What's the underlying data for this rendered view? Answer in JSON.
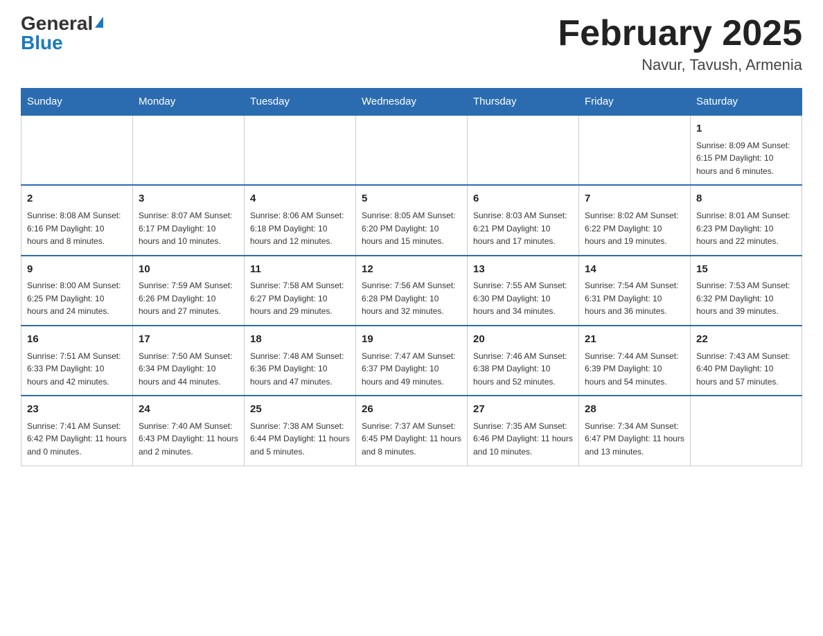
{
  "header": {
    "logo_general": "General",
    "logo_blue": "Blue",
    "month_title": "February 2025",
    "location": "Navur, Tavush, Armenia"
  },
  "weekdays": [
    "Sunday",
    "Monday",
    "Tuesday",
    "Wednesday",
    "Thursday",
    "Friday",
    "Saturday"
  ],
  "weeks": [
    [
      {
        "day": "",
        "info": ""
      },
      {
        "day": "",
        "info": ""
      },
      {
        "day": "",
        "info": ""
      },
      {
        "day": "",
        "info": ""
      },
      {
        "day": "",
        "info": ""
      },
      {
        "day": "",
        "info": ""
      },
      {
        "day": "1",
        "info": "Sunrise: 8:09 AM\nSunset: 6:15 PM\nDaylight: 10 hours and 6 minutes."
      }
    ],
    [
      {
        "day": "2",
        "info": "Sunrise: 8:08 AM\nSunset: 6:16 PM\nDaylight: 10 hours and 8 minutes."
      },
      {
        "day": "3",
        "info": "Sunrise: 8:07 AM\nSunset: 6:17 PM\nDaylight: 10 hours and 10 minutes."
      },
      {
        "day": "4",
        "info": "Sunrise: 8:06 AM\nSunset: 6:18 PM\nDaylight: 10 hours and 12 minutes."
      },
      {
        "day": "5",
        "info": "Sunrise: 8:05 AM\nSunset: 6:20 PM\nDaylight: 10 hours and 15 minutes."
      },
      {
        "day": "6",
        "info": "Sunrise: 8:03 AM\nSunset: 6:21 PM\nDaylight: 10 hours and 17 minutes."
      },
      {
        "day": "7",
        "info": "Sunrise: 8:02 AM\nSunset: 6:22 PM\nDaylight: 10 hours and 19 minutes."
      },
      {
        "day": "8",
        "info": "Sunrise: 8:01 AM\nSunset: 6:23 PM\nDaylight: 10 hours and 22 minutes."
      }
    ],
    [
      {
        "day": "9",
        "info": "Sunrise: 8:00 AM\nSunset: 6:25 PM\nDaylight: 10 hours and 24 minutes."
      },
      {
        "day": "10",
        "info": "Sunrise: 7:59 AM\nSunset: 6:26 PM\nDaylight: 10 hours and 27 minutes."
      },
      {
        "day": "11",
        "info": "Sunrise: 7:58 AM\nSunset: 6:27 PM\nDaylight: 10 hours and 29 minutes."
      },
      {
        "day": "12",
        "info": "Sunrise: 7:56 AM\nSunset: 6:28 PM\nDaylight: 10 hours and 32 minutes."
      },
      {
        "day": "13",
        "info": "Sunrise: 7:55 AM\nSunset: 6:30 PM\nDaylight: 10 hours and 34 minutes."
      },
      {
        "day": "14",
        "info": "Sunrise: 7:54 AM\nSunset: 6:31 PM\nDaylight: 10 hours and 36 minutes."
      },
      {
        "day": "15",
        "info": "Sunrise: 7:53 AM\nSunset: 6:32 PM\nDaylight: 10 hours and 39 minutes."
      }
    ],
    [
      {
        "day": "16",
        "info": "Sunrise: 7:51 AM\nSunset: 6:33 PM\nDaylight: 10 hours and 42 minutes."
      },
      {
        "day": "17",
        "info": "Sunrise: 7:50 AM\nSunset: 6:34 PM\nDaylight: 10 hours and 44 minutes."
      },
      {
        "day": "18",
        "info": "Sunrise: 7:48 AM\nSunset: 6:36 PM\nDaylight: 10 hours and 47 minutes."
      },
      {
        "day": "19",
        "info": "Sunrise: 7:47 AM\nSunset: 6:37 PM\nDaylight: 10 hours and 49 minutes."
      },
      {
        "day": "20",
        "info": "Sunrise: 7:46 AM\nSunset: 6:38 PM\nDaylight: 10 hours and 52 minutes."
      },
      {
        "day": "21",
        "info": "Sunrise: 7:44 AM\nSunset: 6:39 PM\nDaylight: 10 hours and 54 minutes."
      },
      {
        "day": "22",
        "info": "Sunrise: 7:43 AM\nSunset: 6:40 PM\nDaylight: 10 hours and 57 minutes."
      }
    ],
    [
      {
        "day": "23",
        "info": "Sunrise: 7:41 AM\nSunset: 6:42 PM\nDaylight: 11 hours and 0 minutes."
      },
      {
        "day": "24",
        "info": "Sunrise: 7:40 AM\nSunset: 6:43 PM\nDaylight: 11 hours and 2 minutes."
      },
      {
        "day": "25",
        "info": "Sunrise: 7:38 AM\nSunset: 6:44 PM\nDaylight: 11 hours and 5 minutes."
      },
      {
        "day": "26",
        "info": "Sunrise: 7:37 AM\nSunset: 6:45 PM\nDaylight: 11 hours and 8 minutes."
      },
      {
        "day": "27",
        "info": "Sunrise: 7:35 AM\nSunset: 6:46 PM\nDaylight: 11 hours and 10 minutes."
      },
      {
        "day": "28",
        "info": "Sunrise: 7:34 AM\nSunset: 6:47 PM\nDaylight: 11 hours and 13 minutes."
      },
      {
        "day": "",
        "info": ""
      }
    ]
  ]
}
